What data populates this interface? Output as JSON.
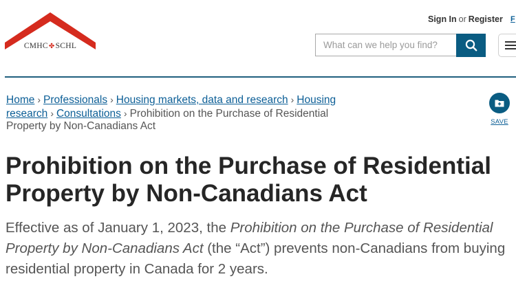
{
  "logo": {
    "text_left": "CMHC",
    "text_right": "SCHL"
  },
  "header": {
    "sign_in": "Sign In",
    "or": "or",
    "register": "Register",
    "lang": "F",
    "search_placeholder": "What can we help you find?"
  },
  "icons": {
    "search": "search-icon",
    "menu": "hamburger-menu-icon",
    "save": "folder-save-icon",
    "leaf": "maple-leaf-icon"
  },
  "colors": {
    "brand_red": "#d52b1e",
    "accent_teal": "#0a5c82",
    "link": "#0b5e96",
    "divider": "#1f5f7e"
  },
  "breadcrumb": {
    "items": [
      "Home",
      "Professionals",
      "Housing markets, data and research",
      "Housing research",
      "Consultations"
    ],
    "current": "Prohibition on the Purchase of Residential Property by Non-Canadians Act"
  },
  "save": {
    "label": "SAVE"
  },
  "page": {
    "title": "Prohibition on the Purchase of Residential Property by Non-Canadians Act",
    "intro_prefix": "Effective as of January 1, 2023, the",
    "intro_italic": "Prohibition on the Purchase of Residential Property by Non-Canadians Act",
    "intro_suffix": "(the “Act”) prevents non-Canadians from buying residential property in Canada for 2 years."
  }
}
